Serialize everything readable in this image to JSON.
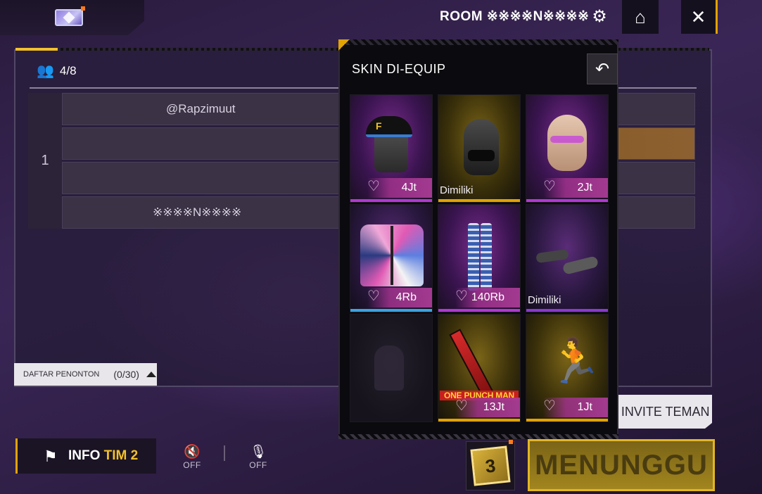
{
  "header": {
    "room_label": "ROOM ※※※※N※※※※",
    "icons": {
      "wallet": "diamond-card-icon",
      "settings": "gear-icon",
      "home": "home-icon",
      "close": "close-icon"
    }
  },
  "lobby": {
    "player_count": "4/8",
    "team_number": "1",
    "slots": [
      "@Rapzimuut",
      "",
      "",
      "※※※※N※※※※"
    ]
  },
  "spectators": {
    "label": "DAFTAR PENONTON",
    "count": "(0/30)"
  },
  "bottom": {
    "info_label": "INFO ",
    "info_team": "TIM 2",
    "speaker_state": "OFF",
    "mic_state": "OFF",
    "invite_label": "INVITE TEMAN",
    "dice_number": "3",
    "wait_label": "MENUNGGU"
  },
  "popup": {
    "title": "SKIN DI-EQUIP",
    "items": [
      {
        "name": "cap",
        "label": "4Jt",
        "owned": false
      },
      {
        "name": "balaclava",
        "label": "Dimiliki",
        "owned": true
      },
      {
        "name": "face-paint",
        "label": "2Jt",
        "owned": false
      },
      {
        "name": "jacket",
        "label": "4Rb",
        "owned": false
      },
      {
        "name": "pants",
        "label": "140Rb",
        "owned": false
      },
      {
        "name": "sandals",
        "label": "Dimiliki",
        "owned": true
      },
      {
        "name": "empty-slot",
        "label": "",
        "owned": false
      },
      {
        "name": "bazooka",
        "label": "13Jt",
        "owned": false,
        "tag": "ONE PUNCH MAN"
      },
      {
        "name": "emote",
        "label": "1Jt",
        "owned": false
      }
    ]
  },
  "colors": {
    "accent_gold": "#e2a300",
    "pink": "#b03ad0",
    "background": "#2a1b3e"
  }
}
